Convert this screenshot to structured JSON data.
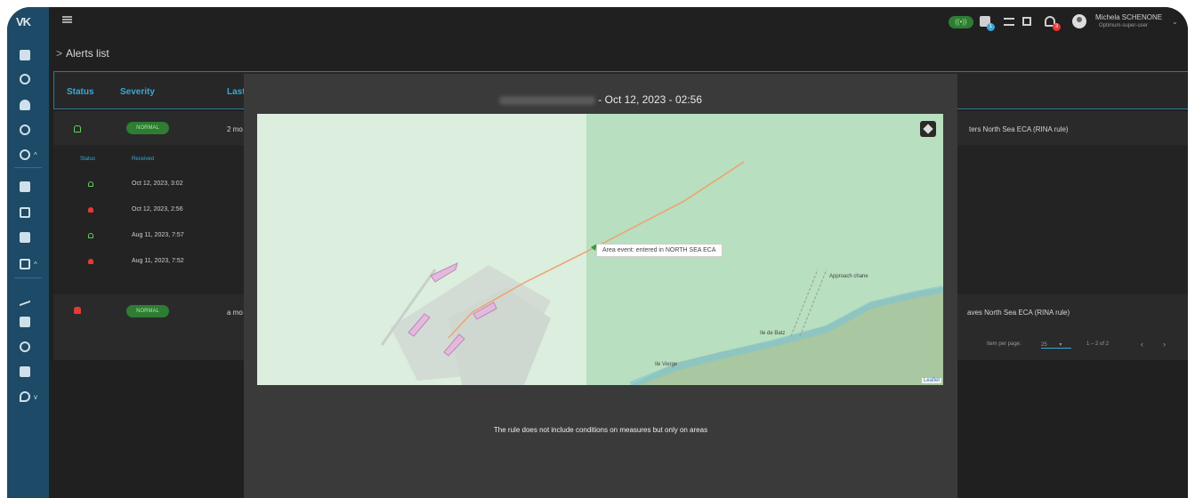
{
  "app": {
    "logo": "VK"
  },
  "topbar": {
    "user_name": "Michela SCHENONE",
    "user_role": "Optimum-super-user",
    "notification_count": "1",
    "alerts_count": "3"
  },
  "breadcrumb": {
    "title": "Alerts list"
  },
  "table": {
    "headers": [
      "Status",
      "Severity",
      "Last"
    ],
    "rows": [
      {
        "severity": "NORMAL",
        "last": "2 mo",
        "trailing": "ters North Sea ECA (RINA rule)"
      },
      {
        "severity": "NORMAL",
        "last": "a mo",
        "trailing": "aves North Sea ECA (RINA rule)"
      }
    ],
    "sub_headers": [
      "Status",
      "Received"
    ],
    "sub_rows": [
      {
        "status": "ok",
        "received": "Oct 12, 2023, 3:02"
      },
      {
        "status": "alert",
        "received": "Oct 12, 2023, 2:56"
      },
      {
        "status": "ok",
        "received": "Aug 11, 2023, 7:57"
      },
      {
        "status": "alert",
        "received": "Aug 11, 2023, 7:52"
      }
    ],
    "pager": {
      "items_label": "Item per page:",
      "items_per_page": "25",
      "range": "1 – 2 of 2"
    }
  },
  "modal": {
    "title_date": " - Oct 12, 2023 - 02:56",
    "popup": "Area event: entered in NORTH SEA ECA",
    "attribution": "Leaflet",
    "map_labels": {
      "approach": "Approach chane",
      "ile_de_batz": "Ile de Batz",
      "ile_verte": "Ile Vierge"
    },
    "note": "The rule does not include conditions on measures but only on areas"
  },
  "colors": {
    "sidebar": "#1d4a66",
    "accent": "#3aa7d6",
    "normal": "#2e7d32",
    "alert": "#e53935",
    "track": "#f0a070"
  }
}
